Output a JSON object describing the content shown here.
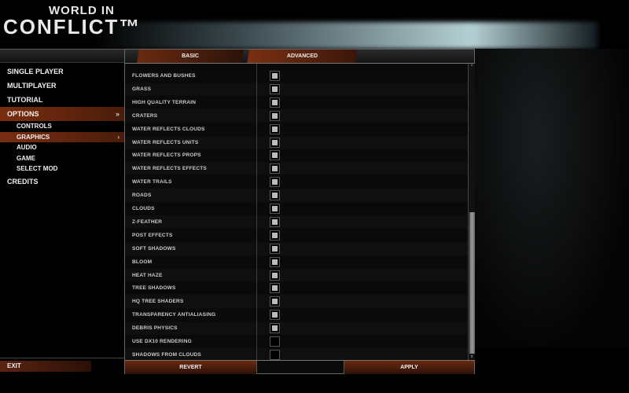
{
  "logo": {
    "line1": "WORLD IN",
    "line2": "CONFLICT™"
  },
  "nav": {
    "items": [
      {
        "label": "SINGLE PLAYER",
        "level": "main"
      },
      {
        "label": "MULTIPLAYER",
        "level": "main"
      },
      {
        "label": "TUTORIAL",
        "level": "main"
      },
      {
        "label": "OPTIONS",
        "level": "main",
        "selected": true,
        "chevron": "»"
      },
      {
        "label": "CONTROLS",
        "level": "sub"
      },
      {
        "label": "GRAPHICS",
        "level": "sub",
        "selected": true,
        "chevron": "›"
      },
      {
        "label": "AUDIO",
        "level": "sub"
      },
      {
        "label": "GAME",
        "level": "sub"
      },
      {
        "label": "SELECT MOD",
        "level": "sub"
      },
      {
        "label": "CREDITS",
        "level": "main"
      }
    ],
    "exit": "EXIT"
  },
  "tabs": {
    "basic": "BASIC",
    "advanced": "ADVANCED"
  },
  "settings": [
    {
      "label": "FLOWERS AND BUSHES",
      "checked": true
    },
    {
      "label": "GRASS",
      "checked": true
    },
    {
      "label": "HIGH QUALITY TERRAIN",
      "checked": true
    },
    {
      "label": "CRATERS",
      "checked": true
    },
    {
      "label": "WATER REFLECTS CLOUDS",
      "checked": true
    },
    {
      "label": "WATER REFLECTS UNITS",
      "checked": true
    },
    {
      "label": "WATER REFLECTS PROPS",
      "checked": true
    },
    {
      "label": "WATER REFLECTS EFFECTS",
      "checked": true
    },
    {
      "label": "WATER TRAILS",
      "checked": true
    },
    {
      "label": "ROADS",
      "checked": true
    },
    {
      "label": "CLOUDS",
      "checked": true
    },
    {
      "label": "Z-FEATHER",
      "checked": true
    },
    {
      "label": "POST EFFECTS",
      "checked": true
    },
    {
      "label": "SOFT SHADOWS",
      "checked": true
    },
    {
      "label": "BLOOM",
      "checked": true
    },
    {
      "label": "HEAT HAZE",
      "checked": true
    },
    {
      "label": "TREE SHADOWS",
      "checked": true
    },
    {
      "label": "HQ TREE SHADERS",
      "checked": true
    },
    {
      "label": "TRANSPARENCY ANTIALIASING",
      "checked": true
    },
    {
      "label": "DEBRIS PHYSICS",
      "checked": true
    },
    {
      "label": "USE DX10 RENDERING",
      "checked": false
    },
    {
      "label": "SHADOWS FROM CLOUDS",
      "checked": false
    }
  ],
  "scrollbar": {
    "position_fraction": 0.5,
    "visible_fraction": 0.5
  },
  "buttons": {
    "revert": "REVERT",
    "apply": "APPLY"
  }
}
